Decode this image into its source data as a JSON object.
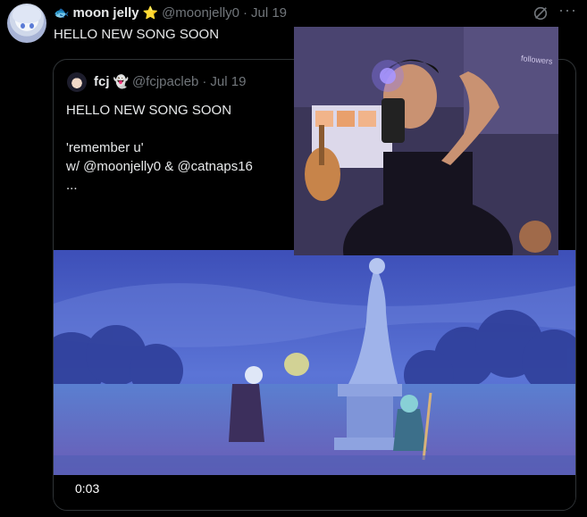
{
  "tweet": {
    "author_name": "moon jelly",
    "author_name_prefix_emoji": "🐟",
    "author_name_suffix_emoji": "⭐",
    "handle": "@moonjelly0",
    "separator": "·",
    "date": "Jul 19",
    "text": "HELLO NEW SONG SOON",
    "more_glyph": "···"
  },
  "quoted_tweet": {
    "author_name": "fcj",
    "author_emoji": "👻",
    "handle": "@fcjpacleb",
    "separator": "·",
    "date": "Jul 19",
    "lines": [
      "HELLO NEW SONG SOON",
      "",
      "'remember u'",
      "w/ @moonjelly0 & @catnaps16",
      "..."
    ]
  },
  "video": {
    "timestamp": "0:03"
  },
  "webcam_overlay": {
    "label": "followers"
  },
  "colors": {
    "background": "#000000",
    "text": "#e7e9ea",
    "muted": "#71767b",
    "border": "#2f3336"
  }
}
